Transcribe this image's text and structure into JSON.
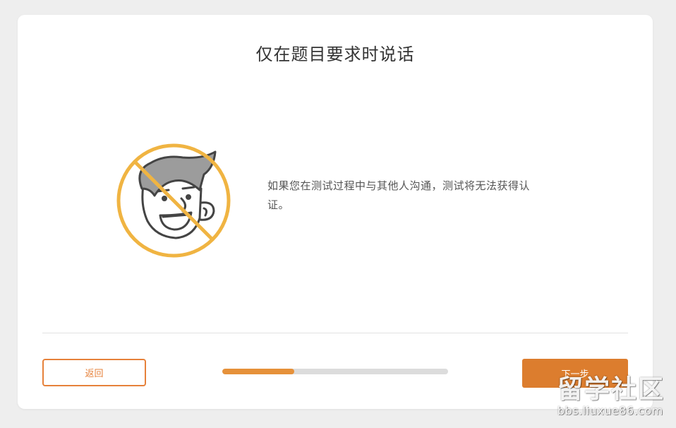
{
  "dialog": {
    "title": "仅在题目要求时说话",
    "illustration_icon": "no-talking-face-icon",
    "message": "如果您在测试过程中与其他人沟通，测试将无法获得认证。"
  },
  "footer": {
    "back_label": "返回",
    "next_label": "下一步",
    "progress_fraction": 0.32
  },
  "watermark": {
    "main": "留学社区",
    "sub": "bbs.liuxue86.com"
  },
  "colors": {
    "accent": "#e6813a",
    "next_button": "#dc7d2e",
    "prohibition_ring": "#f0b442",
    "progress_track": "#dcdcdc"
  }
}
